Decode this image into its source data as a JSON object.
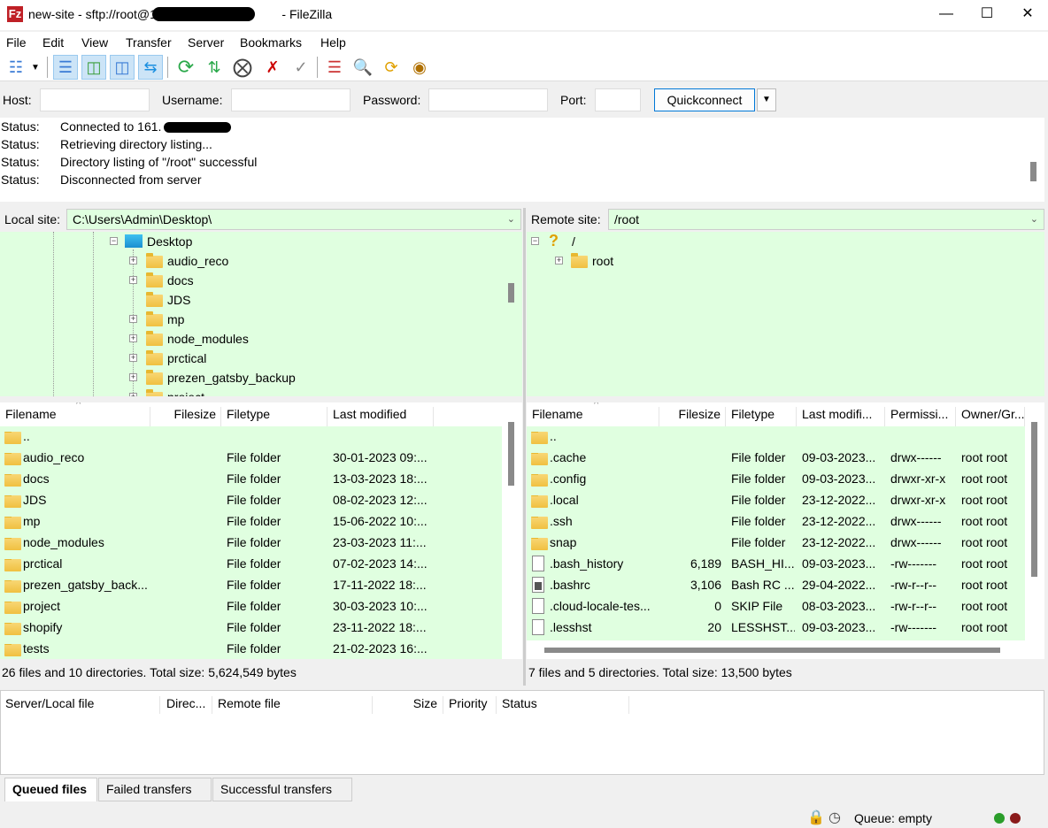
{
  "window": {
    "title": "new-site - sftp://root@161.",
    "title_suffix": "- FileZilla",
    "app_icon": "filezilla-logo",
    "logo_text": "Fz"
  },
  "menu": [
    "File",
    "Edit",
    "View",
    "Transfer",
    "Server",
    "Bookmarks",
    "Help"
  ],
  "toolbar": [
    "site-manager",
    "local-dir-tree",
    "remote-dir-tree",
    "toggle-transfer-queue",
    "refresh",
    "process-queue",
    "cancel",
    "disconnect",
    "reconnect",
    "directory-listing-filters",
    "toggle-filters",
    "sync-browsing",
    "search"
  ],
  "quickconnect": {
    "host_label": "Host:",
    "username_label": "Username:",
    "password_label": "Password:",
    "port_label": "Port:",
    "host": "",
    "username": "",
    "password": "",
    "port": "",
    "button": "Quickconnect"
  },
  "log": [
    {
      "k": "Status:",
      "v": "Connected to 161."
    },
    {
      "k": "Status:",
      "v": "Retrieving directory listing..."
    },
    {
      "k": "Status:",
      "v": "Directory listing of \"/root\" successful"
    },
    {
      "k": "Status:",
      "v": "Disconnected from server"
    }
  ],
  "local": {
    "site_label": "Local site:",
    "path": "C:\\Users\\Admin\\Desktop\\",
    "tree_root": "Desktop",
    "tree": [
      {
        "n": "audio_reco",
        "exp": true
      },
      {
        "n": "docs",
        "exp": true
      },
      {
        "n": "JDS",
        "exp": false
      },
      {
        "n": "mp",
        "exp": true
      },
      {
        "n": "node_modules",
        "exp": true
      },
      {
        "n": "prctical",
        "exp": true
      },
      {
        "n": "prezen_gatsby_backup",
        "exp": true
      },
      {
        "n": "project",
        "exp": true
      }
    ],
    "columns": [
      "Filename",
      "Filesize",
      "Filetype",
      "Last modified"
    ],
    "rows": [
      [
        "..",
        "",
        "",
        ""
      ],
      [
        "audio_reco",
        "",
        "File folder",
        "30-01-2023 09:..."
      ],
      [
        "docs",
        "",
        "File folder",
        "13-03-2023 18:..."
      ],
      [
        "JDS",
        "",
        "File folder",
        "08-02-2023 12:..."
      ],
      [
        "mp",
        "",
        "File folder",
        "15-06-2022 10:..."
      ],
      [
        "node_modules",
        "",
        "File folder",
        "23-03-2023 11:..."
      ],
      [
        "prctical",
        "",
        "File folder",
        "07-02-2023 14:..."
      ],
      [
        "prezen_gatsby_back...",
        "",
        "File folder",
        "17-11-2022 18:..."
      ],
      [
        "project",
        "",
        "File folder",
        "30-03-2023 10:..."
      ],
      [
        "shopify",
        "",
        "File folder",
        "23-11-2022 18:..."
      ],
      [
        "tests",
        "",
        "File folder",
        "21-02-2023 16:..."
      ]
    ],
    "summary": "26 files and 10 directories. Total size: 5,624,549 bytes"
  },
  "remote": {
    "site_label": "Remote site:",
    "path": "/root",
    "tree_root": "/",
    "tree": [
      {
        "n": "root"
      }
    ],
    "columns": [
      "Filename",
      "Filesize",
      "Filetype",
      "Last modifi...",
      "Permissi...",
      "Owner/Gr..."
    ],
    "rows": [
      [
        "..",
        "",
        "",
        "",
        "",
        "",
        "folder"
      ],
      [
        ".cache",
        "",
        "File folder",
        "09-03-2023...",
        "drwx------",
        "root root",
        "folder"
      ],
      [
        ".config",
        "",
        "File folder",
        "09-03-2023...",
        "drwxr-xr-x",
        "root root",
        "folder"
      ],
      [
        ".local",
        "",
        "File folder",
        "23-12-2022...",
        "drwxr-xr-x",
        "root root",
        "folder"
      ],
      [
        ".ssh",
        "",
        "File folder",
        "23-12-2022...",
        "drwx------",
        "root root",
        "folder"
      ],
      [
        "snap",
        "",
        "File folder",
        "23-12-2022...",
        "drwx------",
        "root root",
        "folder"
      ],
      [
        ".bash_history",
        "6,189",
        "BASH_HI...",
        "09-03-2023...",
        "-rw-------",
        "root root",
        "file"
      ],
      [
        ".bashrc",
        "3,106",
        "Bash RC ...",
        "29-04-2022...",
        "-rw-r--r--",
        "root root",
        "dark"
      ],
      [
        ".cloud-locale-tes...",
        "0",
        "SKIP File",
        "08-03-2023...",
        "-rw-r--r--",
        "root root",
        "file"
      ],
      [
        ".lesshst",
        "20",
        "LESSHST...",
        "09-03-2023...",
        "-rw-------",
        "root root",
        "file"
      ]
    ],
    "summary": "7 files and 5 directories. Total size: 13,500 bytes"
  },
  "queue": {
    "columns": [
      "Server/Local file",
      "Direc...",
      "Remote file",
      "Size",
      "Priority",
      "Status"
    ],
    "tabs": [
      "Queued files",
      "Failed transfers",
      "Successful transfers"
    ],
    "status": "Queue: empty"
  },
  "colors": {
    "list_bg": "#e0ffe0",
    "accent": "#0078d7",
    "logo": "#bf2026"
  }
}
